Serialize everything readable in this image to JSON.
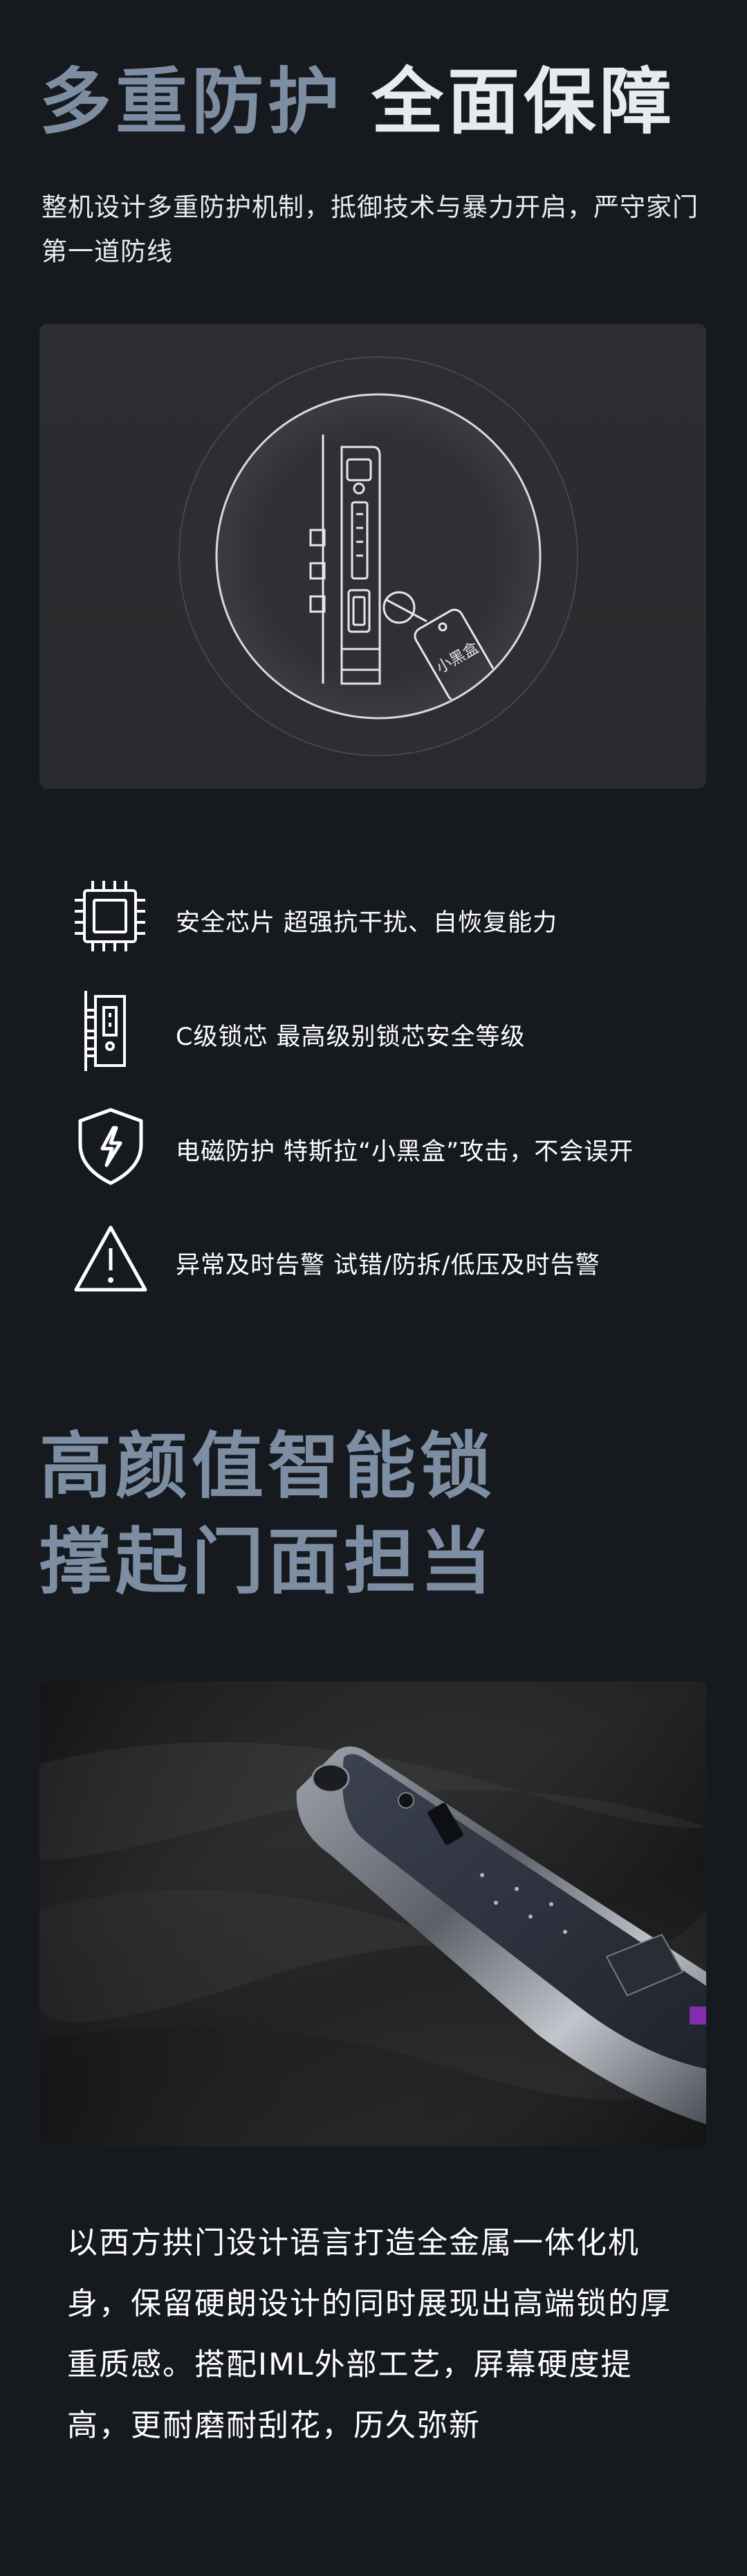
{
  "section1": {
    "title_part1": "多重防护",
    "title_part2": "全面保障",
    "subtitle": "整机设计多重防护机制，抵御技术与暴力开启，严守家门第一道防线",
    "diagram_tag": "小黑盒"
  },
  "features": [
    {
      "icon": "chip-icon",
      "name": "安全芯片",
      "desc": "超强抗干扰、自恢复能力"
    },
    {
      "icon": "lock-cylinder-icon",
      "name": "C级锁芯",
      "desc": "最高级别锁芯安全等级"
    },
    {
      "icon": "shield-lightning-icon",
      "name": "电磁防护",
      "desc": "特斯拉“小黑盒”攻击，不会误开"
    },
    {
      "icon": "warning-icon",
      "name": "异常及时告警",
      "desc": "试错/防拆/低压及时告警"
    }
  ],
  "section2": {
    "title_line1": "高颜值智能锁",
    "title_line2": "撑起门面担当",
    "body": "以西方拱门设计语言打造全金属一体化机身，保留硬朗设计的同时展现出高端锁的厚重质感。搭配IML外部工艺，屏幕硬度提高，更耐磨耐刮花，历久弥新"
  },
  "colors": {
    "background": "#16191e",
    "title_muted": "#7d8ea3",
    "title_bright": "#e6ebf0",
    "card": "#2b2d31"
  }
}
